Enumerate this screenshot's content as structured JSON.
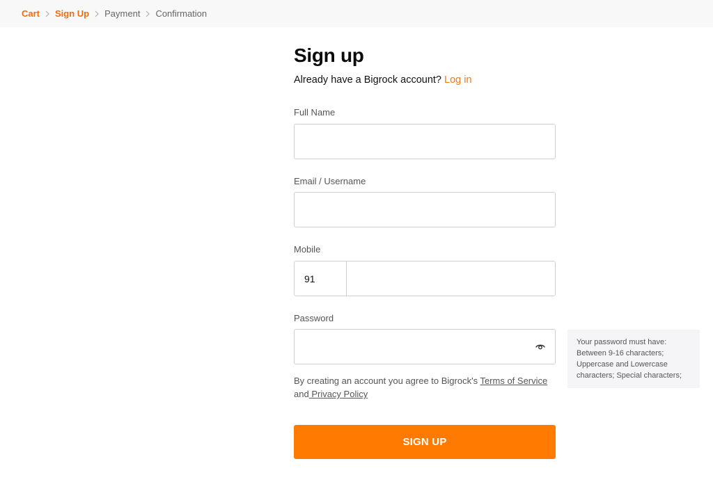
{
  "breadcrumb": {
    "items": [
      {
        "label": "Cart",
        "active": true
      },
      {
        "label": "Sign Up",
        "active": true
      },
      {
        "label": "Payment",
        "active": false
      },
      {
        "label": "Confirmation",
        "active": false
      }
    ]
  },
  "form": {
    "title": "Sign up",
    "login_prompt": "Already have a Bigrock account?",
    "login_link": "Log in",
    "full_name": {
      "label": "Full Name",
      "value": ""
    },
    "email": {
      "label": "Email / Username",
      "value": ""
    },
    "mobile": {
      "label": "Mobile",
      "country_code": "91",
      "value": ""
    },
    "password": {
      "label": "Password",
      "value": ""
    },
    "terms": {
      "prefix": "By creating an account you agree to Bigrock's ",
      "tos_link": "Terms of Service",
      "and": " and",
      "privacy_link": " Privacy Policy"
    },
    "submit_label": "SIGN UP"
  },
  "password_hint": {
    "lines": [
      "Your password must have:",
      "Between 9-16 characters;",
      "Uppercase and Lowercase characters; Special characters;"
    ]
  },
  "colors": {
    "accent": "#ff7a00",
    "link": "#f27a16"
  },
  "icons": {
    "breadcrumb_separator": "chevron-right-icon",
    "password_toggle": "eye-icon"
  }
}
